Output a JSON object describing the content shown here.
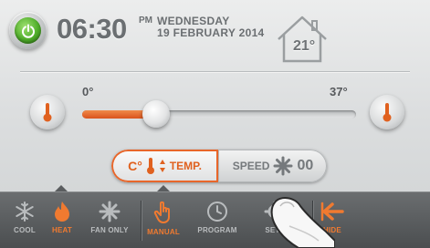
{
  "status": {
    "time": "06:30",
    "ampm": "PM",
    "day": "WEDNESDAY",
    "date": "19 FEBRUARY 2014",
    "indoor_temp": "21°"
  },
  "slider": {
    "min_label": "0°",
    "max_label": "37°",
    "value_fraction": 0.27
  },
  "controls": {
    "unit": "C°",
    "temp_label": "TEMP.",
    "speed_label": "SPEED",
    "speed_value": "00"
  },
  "tabs": {
    "cool": "COOL",
    "heat": "HEAT",
    "fan_only": "FAN ONLY",
    "manual": "MANUAL",
    "program": "PROGRAM",
    "settings": "SETT",
    "hide": "HIDE"
  },
  "colors": {
    "accent": "#e8662a",
    "power": "#4fae2a",
    "bar": "#55585a"
  }
}
